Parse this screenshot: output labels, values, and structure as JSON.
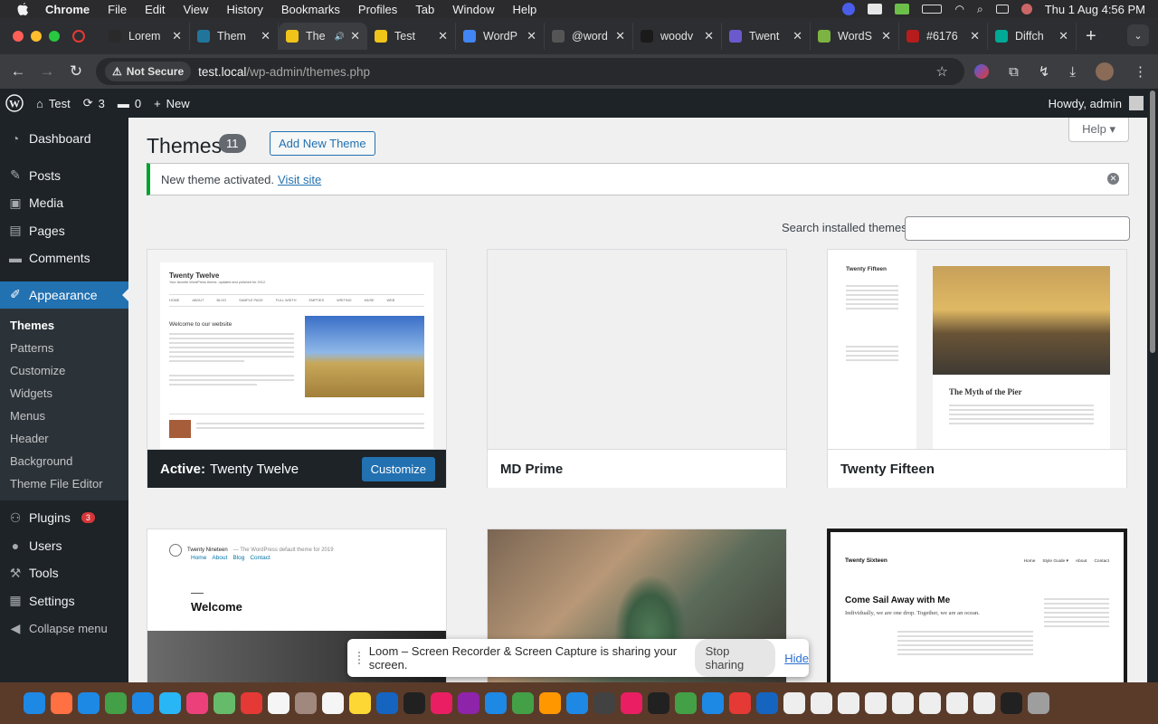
{
  "menubar": {
    "app": "Chrome",
    "items": [
      "File",
      "Edit",
      "View",
      "History",
      "Bookmarks",
      "Profiles",
      "Tab",
      "Window",
      "Help"
    ],
    "datetime": "Thu 1 Aug  4:56 PM"
  },
  "tabs": [
    {
      "title": "Lorem",
      "fav_color": "#2a2a2a",
      "active": false
    },
    {
      "title": "Them",
      "fav_color": "#21759b",
      "active": false
    },
    {
      "title": "The",
      "fav_color": "#f0c419",
      "active": true
    },
    {
      "title": "Test",
      "fav_color": "#f0c419",
      "active": false
    },
    {
      "title": "WordP",
      "fav_color": "#4285f4",
      "active": false
    },
    {
      "title": "@word",
      "fav_color": "#555555",
      "active": false
    },
    {
      "title": "woodv",
      "fav_color": "#1a1a1a",
      "active": false
    },
    {
      "title": "Twent",
      "fav_color": "#6a5acd",
      "active": false
    },
    {
      "title": "WordS",
      "fav_color": "#7cb342",
      "active": false
    },
    {
      "title": "#6176",
      "fav_color": "#b71c1c",
      "active": false
    },
    {
      "title": "Diffch",
      "fav_color": "#00a896",
      "active": false
    }
  ],
  "addressbar": {
    "security": "Not Secure",
    "host": "test.local",
    "path": "/wp-admin/themes.php"
  },
  "adminbar": {
    "site": "Test",
    "updates": "3",
    "comments": "0",
    "new_label": "New",
    "howdy": "Howdy, admin"
  },
  "sidebar": {
    "items": [
      {
        "label": "Dashboard",
        "icon": "dashboard-icon",
        "glyph": "◔"
      },
      {
        "label": "Posts",
        "icon": "pin-icon",
        "glyph": "✎"
      },
      {
        "label": "Media",
        "icon": "media-icon",
        "glyph": "▣"
      },
      {
        "label": "Pages",
        "icon": "pages-icon",
        "glyph": "▤"
      },
      {
        "label": "Comments",
        "icon": "comments-icon",
        "glyph": "▬"
      },
      {
        "label": "Appearance",
        "icon": "brush-icon",
        "glyph": "✐"
      }
    ],
    "submenu": [
      "Themes",
      "Patterns",
      "Customize",
      "Widgets",
      "Menus",
      "Header",
      "Background",
      "Theme File Editor"
    ],
    "bottom": [
      {
        "label": "Plugins",
        "icon": "plugins-icon",
        "glyph": "⚇",
        "badge": "3"
      },
      {
        "label": "Users",
        "icon": "users-icon",
        "glyph": "●"
      },
      {
        "label": "Tools",
        "icon": "tools-icon",
        "glyph": "⚒"
      },
      {
        "label": "Settings",
        "icon": "settings-icon",
        "glyph": "▦"
      },
      {
        "label": "Collapse menu",
        "icon": "collapse-icon",
        "glyph": "◀"
      }
    ]
  },
  "page": {
    "title": "Themes",
    "count": "11",
    "add_new": "Add New Theme",
    "help": "Help ▾",
    "notice": "New theme activated.",
    "notice_link": "Visit site",
    "search_label": "Search installed themes",
    "search_value": ""
  },
  "themes": {
    "active_prefix": "Active:",
    "active_name": "Twenty Twelve",
    "customize": "Customize",
    "md_prime": "MD Prime",
    "fifteen": "Twenty Fifteen",
    "twelve_shot_title": "Twenty Twelve",
    "twelve_shot_tagline": "Your favorite WordPress theme, updated and polished for 2012.",
    "twelve_shot_nav": [
      "HOME",
      "ABOUT",
      "BLOG",
      "SAMPLE PAGE",
      "FULL WIDTH",
      "EMPTIES",
      "WRITING",
      "MUSE",
      "WEB"
    ],
    "twelve_shot_heading": "Welcome to our website",
    "fifteen_shot_title": "Twenty Fifteen",
    "fifteen_shot_article": "The Myth of the Pier",
    "nineteen_shot_title": "Twenty Nineteen",
    "nineteen_shot_tagline": "— The WordPress default theme for 2019",
    "nineteen_shot_nav": [
      "Home",
      "About",
      "Blog",
      "Contact"
    ],
    "nineteen_shot_welcome": "Welcome",
    "sixteen_shot_title": "Twenty Sixteen",
    "sixteen_shot_nav": [
      "Home",
      "Style Guide ▾",
      "About",
      "Contact"
    ],
    "sixteen_shot_heading": "Come Sail Away with Me",
    "sixteen_shot_sub": "Individually, we are one drop. Together, we are an ocean."
  },
  "loom": {
    "message": "Loom – Screen Recorder & Screen Capture is sharing your screen.",
    "stop": "Stop sharing",
    "hide": "Hide"
  },
  "dock_colors": [
    "#1e88e5",
    "#ff7043",
    "#1e88e5",
    "#43a047",
    "#1e88e5",
    "#29b6f6",
    "#ec407a",
    "#66bb6a",
    "#e53935",
    "#f5f5f5",
    "#a1887f",
    "#f5f5f5",
    "#fdd835",
    "#1565c0",
    "#212121",
    "#e91e63",
    "#8e24aa",
    "#1e88e5",
    "#43a047",
    "#ff9800",
    "#1e88e5",
    "#424242",
    "#e91e63",
    "#212121",
    "#43a047",
    "#1e88e5",
    "#e53935",
    "#1565c0",
    "#eeeeee",
    "#eeeeee",
    "#eeeeee",
    "#eeeeee",
    "#eeeeee",
    "#eeeeee",
    "#eeeeee",
    "#eeeeee",
    "#212121",
    "#9e9e9e"
  ]
}
